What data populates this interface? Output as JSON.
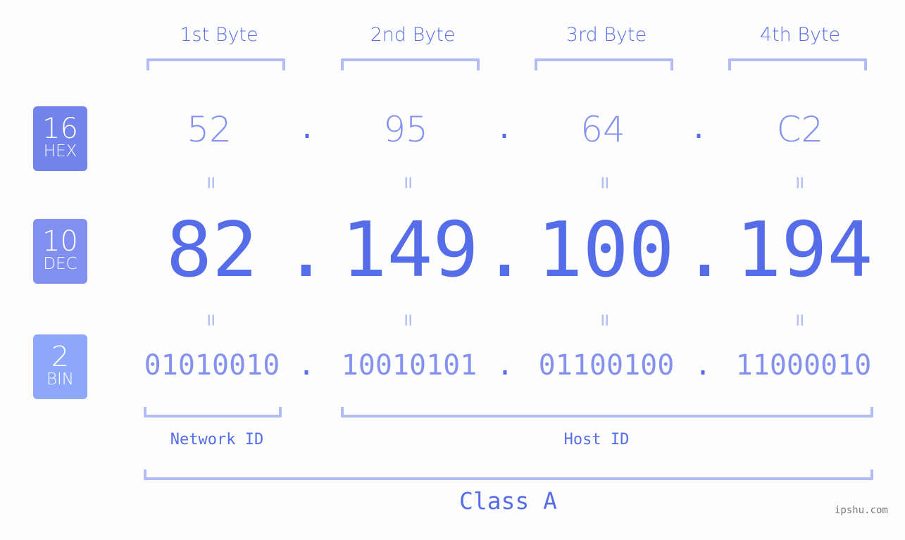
{
  "headers": [
    "1st Byte",
    "2nd Byte",
    "3rd Byte",
    "4th Byte"
  ],
  "badges": {
    "hex": {
      "number": "16",
      "label": "HEX",
      "color": "#7383ec"
    },
    "dec": {
      "number": "10",
      "label": "DEC",
      "color": "#8190f0"
    },
    "bin": {
      "number": "2",
      "label": "BIN",
      "color": "#8da8fb"
    }
  },
  "hex_bytes": [
    "52",
    "95",
    "64",
    "C2"
  ],
  "dec_bytes": [
    "82",
    "149",
    "100",
    "194"
  ],
  "bin_bytes": [
    "01010010",
    "10010101",
    "01100100",
    "11000010"
  ],
  "separator": ".",
  "equals": "=",
  "network_id_label": "Network ID",
  "host_id_label": "Host ID",
  "class_label": "Class A",
  "watermark": "ipshu.com",
  "colors": {
    "accent": "#566de9",
    "light_value": "#8591ee",
    "bracket": "#b3bbf7",
    "background": "#fcfdfc"
  }
}
